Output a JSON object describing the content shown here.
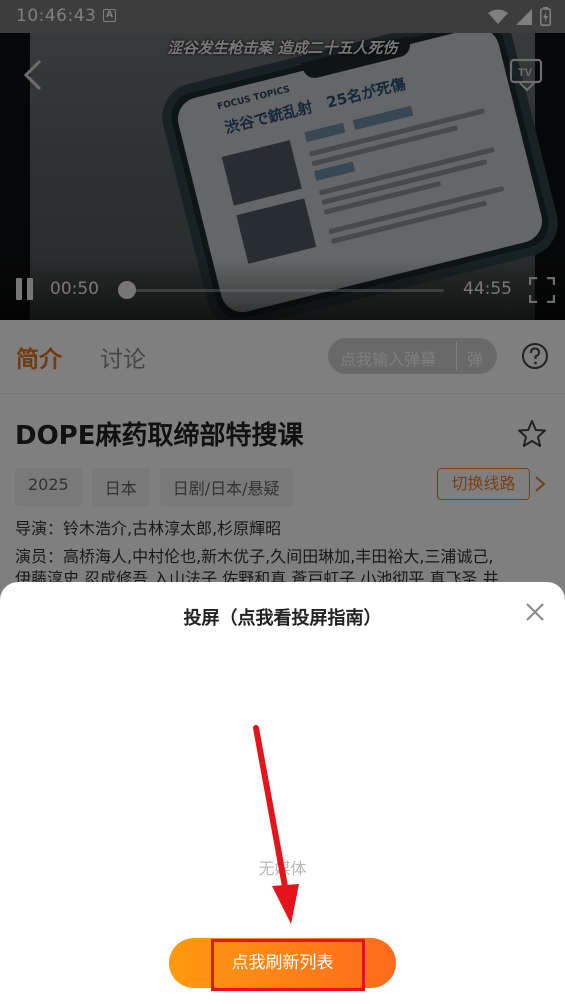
{
  "status_bar": {
    "time": "10:46:43",
    "notification_badge": "A",
    "icons": [
      "wifi-icon",
      "signal-icon",
      "battery-icon"
    ]
  },
  "video": {
    "subtitle": "涩谷发生枪击案 造成二十五人死伤",
    "screen_topics": "FOCUS TOPICS",
    "screen_headline": "渋谷で銃乱射　25名が死傷",
    "current_time": "00:50",
    "total_time": "44:55",
    "progress_fraction": 0.0186,
    "state": "playing"
  },
  "tabs": {
    "intro": "简介",
    "discuss": "讨论",
    "danmu_placeholder": "点我输入弹幕",
    "danmu_button": "弹"
  },
  "detail": {
    "title": "DOPE麻药取缔部特搜课",
    "tags": [
      "2025",
      "日本",
      "日剧/日本/悬疑"
    ],
    "switch_line": "切换线路",
    "director": "导演：铃木浩介,古林淳太郎,杉原輝昭",
    "cast_line1": "演员：高桥海人,中村伦也,新木优子,久间田琳加,丰田裕大,三浦诚己,",
    "cast_line2": "伊藤淳史,忍成修吾,入山法子,佐野和真,蒼戸虹子,小池彻平,真飞圣,井"
  },
  "cast_sheet": {
    "title": "投屏（点我看投屏指南）",
    "empty_text": "无媒体",
    "refresh_button": "点我刷新列表"
  },
  "colors": {
    "accent": "#e8731f",
    "refresh_gradient_start": "#ff9a10",
    "refresh_gradient_end": "#ff6a1c",
    "annotation_red": "#e5141b"
  }
}
